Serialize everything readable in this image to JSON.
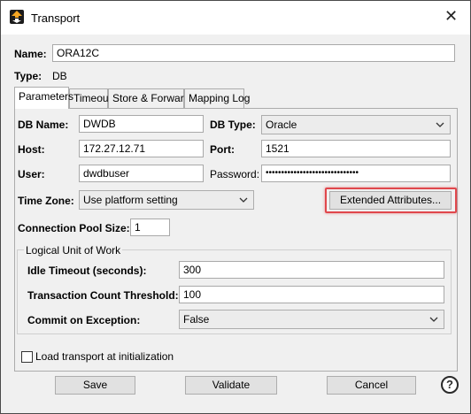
{
  "window": {
    "title": "Transport",
    "close_glyph": "✕",
    "app_icon": "transport-logo-icon"
  },
  "name": {
    "label": "Name:",
    "value": "ORA12C"
  },
  "type": {
    "label": "Type:",
    "value": "DB"
  },
  "tabs": [
    {
      "label": "Parameters",
      "active": true
    },
    {
      "label": "Timeout",
      "active": false
    },
    {
      "label": "Store & Forward",
      "active": false
    },
    {
      "label": "Mapping Log",
      "active": false
    }
  ],
  "params": {
    "db_name": {
      "label": "DB Name:",
      "value": "DWDB"
    },
    "db_type": {
      "label": "DB Type:",
      "value": "Oracle"
    },
    "host": {
      "label": "Host:",
      "value": "172.27.12.71"
    },
    "port": {
      "label": "Port:",
      "value": "1521"
    },
    "user": {
      "label": "User:",
      "value": "dwdbuser"
    },
    "password": {
      "label": "Password:",
      "value": "••••••••••••••••••••••••••••••"
    },
    "time_zone": {
      "label": "Time Zone:",
      "value": "Use platform setting"
    },
    "extended_attributes_label": "Extended Attributes...",
    "pool_size": {
      "label": "Connection Pool Size:",
      "value": "1"
    }
  },
  "luw": {
    "title": "Logical Unit of Work",
    "idle_timeout": {
      "label": "Idle Timeout (seconds):",
      "value": "300"
    },
    "txn_count": {
      "label": "Transaction Count Threshold:",
      "value": "100"
    },
    "commit_on_exception": {
      "label": "Commit on Exception:",
      "value": "False"
    }
  },
  "load_at_init": {
    "label": "Load transport at initialization",
    "checked": false
  },
  "buttons": {
    "save": "Save",
    "validate": "Validate",
    "cancel": "Cancel",
    "help": "?"
  },
  "colors": {
    "highlight": "#e0474c",
    "window_bg": "#f0f0f0"
  }
}
